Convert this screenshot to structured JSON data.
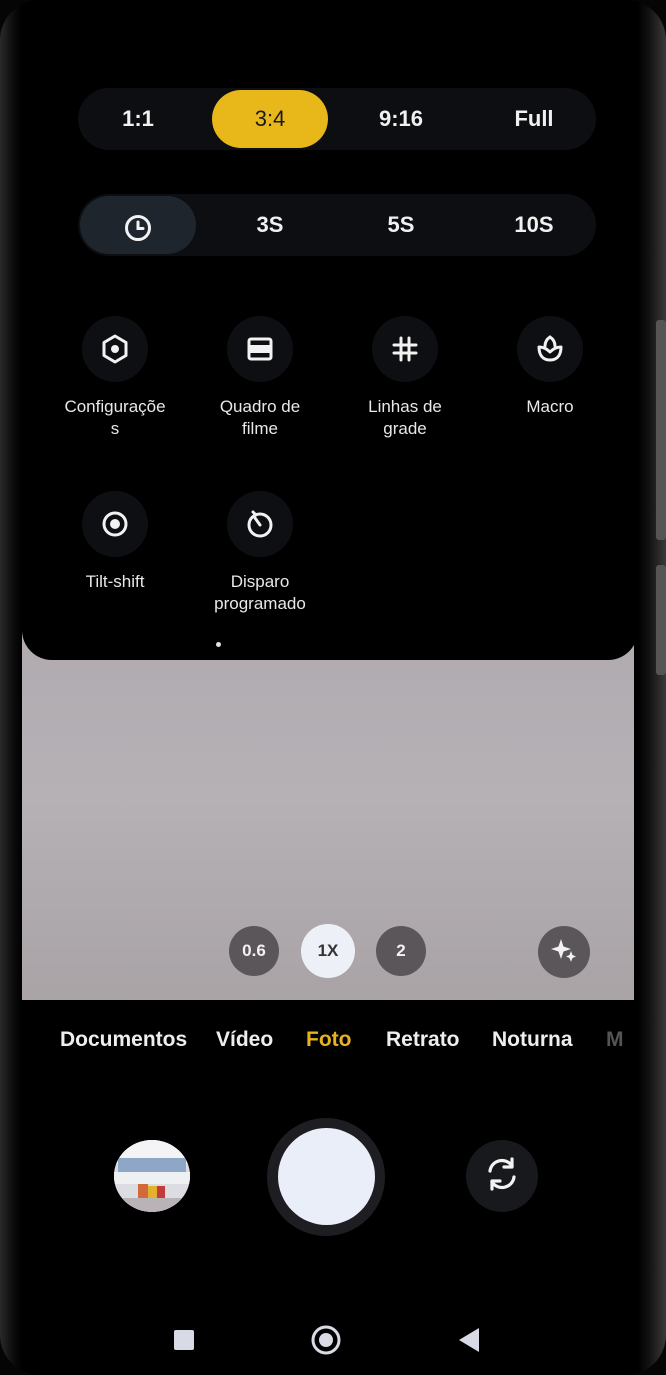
{
  "aspect_ratio": {
    "options": [
      "1:1",
      "3:4",
      "9:16",
      "Full"
    ],
    "selected": "3:4"
  },
  "timer": {
    "icon": "clock-icon",
    "options": [
      "3S",
      "5S",
      "10S"
    ]
  },
  "settings": [
    {
      "icon": "gear-icon",
      "label_line1": "Configuraçõe",
      "label_line2": "s"
    },
    {
      "icon": "film-frame-icon",
      "label_line1": "Quadro de",
      "label_line2": "filme"
    },
    {
      "icon": "grid-lines-icon",
      "label_line1": "Linhas de",
      "label_line2": "grade"
    },
    {
      "icon": "macro-flower-icon",
      "label_line1": "Macro",
      "label_line2": ""
    },
    {
      "icon": "tilt-shift-icon",
      "label_line1": "Tilt-shift",
      "label_line2": ""
    },
    {
      "icon": "timed-shot-icon",
      "label_line1": "Disparo",
      "label_line2": "programado"
    }
  ],
  "zoom": {
    "options": [
      "0.6",
      "1X",
      "2"
    ],
    "selected": "1X"
  },
  "modes": {
    "items": [
      "Documentos",
      "Vídeo",
      "Foto",
      "Retrato",
      "Noturna",
      "M"
    ],
    "selected": "Foto"
  },
  "colors": {
    "accent": "#e8b81b",
    "active_mode": "#e6b21f"
  }
}
